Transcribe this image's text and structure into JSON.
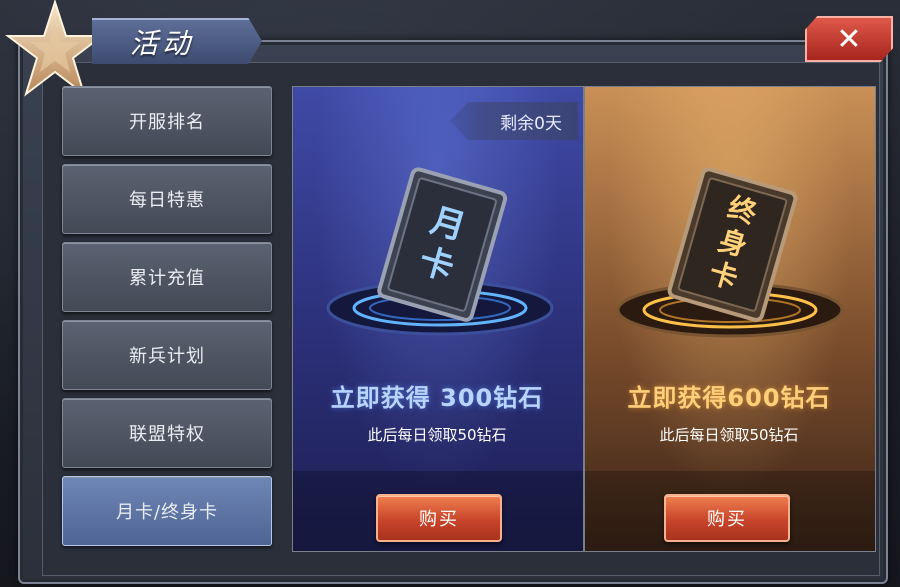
{
  "window": {
    "title": "活动",
    "close_symbol": "✕"
  },
  "sidebar": {
    "items": [
      {
        "label": "开服排名",
        "active": false
      },
      {
        "label": "每日特惠",
        "active": false
      },
      {
        "label": "累计充值",
        "active": false
      },
      {
        "label": "新兵计划",
        "active": false
      },
      {
        "label": "联盟特权",
        "active": false
      },
      {
        "label": "月卡/终身卡",
        "active": true
      }
    ]
  },
  "cards": {
    "monthly": {
      "remaining": "剩余0天",
      "card_title_line1": "月",
      "card_title_line2": "卡",
      "headline": "立即获得 300钻石",
      "subline": "此后每日领取50钻石",
      "buy_label": "购买",
      "accent": "#5aa8ff"
    },
    "lifetime": {
      "card_title_line1": "终",
      "card_title_line2": "身",
      "card_title_line3": "卡",
      "headline": "立即获得600钻石",
      "subline": "此后每日领取50钻石",
      "buy_label": "购买",
      "accent": "#ffb13a"
    }
  }
}
